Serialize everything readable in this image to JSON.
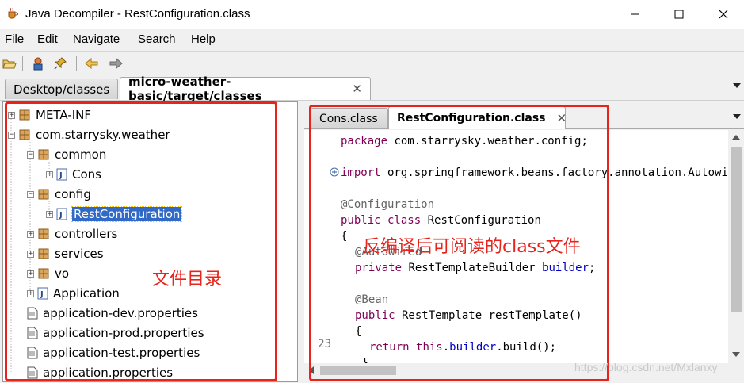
{
  "window": {
    "title": "Java Decompiler - RestConfiguration.class",
    "controls": {
      "minimize": "—",
      "maximize": "☐",
      "close": "✕"
    }
  },
  "menu": [
    "File",
    "Edit",
    "Navigate",
    "Search",
    "Help"
  ],
  "toolbar": {
    "icons": [
      "open-folder-icon",
      "open-type-icon",
      "pin-icon",
      "back-icon",
      "forward-icon"
    ]
  },
  "outer_tabs": [
    {
      "label": "Desktop/classes",
      "active": false
    },
    {
      "label": "micro-weather-basic/target/classes",
      "active": true,
      "close": "✕"
    }
  ],
  "tree": [
    {
      "label": "META-INF",
      "type": "package",
      "expander": "+"
    },
    {
      "label": "com.starrysky.weather",
      "type": "package",
      "expander": "−"
    },
    {
      "label": "common",
      "type": "package",
      "expander": "−"
    },
    {
      "label": "Cons",
      "type": "java",
      "expander": "+"
    },
    {
      "label": "config",
      "type": "package",
      "expander": "−"
    },
    {
      "label": "RestConfiguration",
      "type": "java",
      "expander": "+",
      "selected": true
    },
    {
      "label": "controllers",
      "type": "package",
      "expander": "+"
    },
    {
      "label": "services",
      "type": "package",
      "expander": "+"
    },
    {
      "label": "vo",
      "type": "package",
      "expander": "+"
    },
    {
      "label": "Application",
      "type": "java",
      "expander": "+"
    },
    {
      "label": "application-dev.properties",
      "type": "file"
    },
    {
      "label": "application-prod.properties",
      "type": "file"
    },
    {
      "label": "application-test.properties",
      "type": "file"
    },
    {
      "label": "application.properties",
      "type": "file"
    }
  ],
  "inner_tabs": [
    {
      "label": "Cons.class",
      "active": false
    },
    {
      "label": "RestConfiguration.class",
      "active": true,
      "close": "✕"
    }
  ],
  "code": {
    "lines": [
      "package com.starrysky.weather.config;",
      "import org.springframework.beans.factory.annotation.Autowired;",
      "@Configuration",
      "public class RestConfiguration",
      "{",
      "@Autowired",
      "private RestTemplateBuilder builder;",
      "@Bean",
      "public RestTemplate restTemplate()",
      "{",
      "return this.builder.build();"
    ],
    "line_number": "23",
    "fold_marker": "+"
  },
  "annotations": {
    "tree_label": "文件目录",
    "editor_label": "反编译后可阅读的class文件"
  },
  "watermark": "https://blog.csdn.net/Mxlanxy",
  "colors": {
    "annotation_red": "#e8231b",
    "selection": "#3169c6",
    "keyword": "#7f0055"
  }
}
